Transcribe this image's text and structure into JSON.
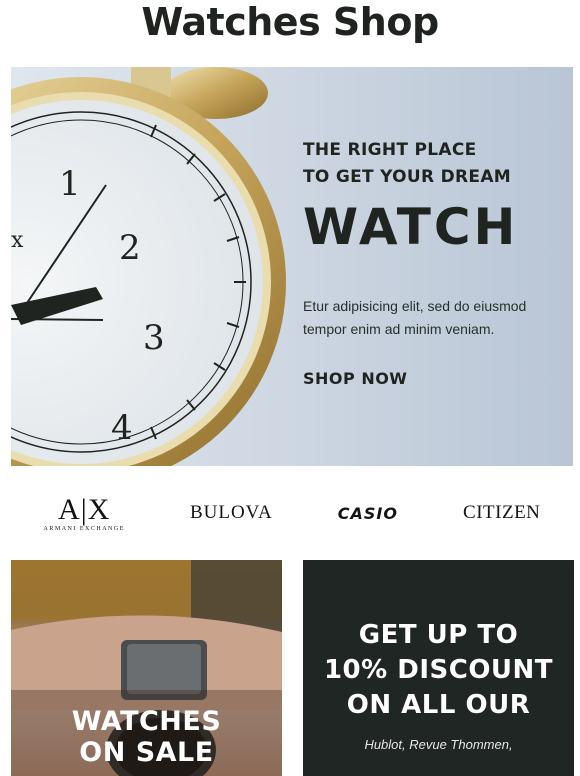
{
  "header": {
    "title": "Watches Shop"
  },
  "hero": {
    "kicker_line1": "THE RIGHT PLACE",
    "kicker_line2": "TO GET YOUR DREAM",
    "headline": "WATCH",
    "body": "Etur adipisicing elit, sed do eiusmod tempor enim ad minim veniam.",
    "cta": "SHOP NOW",
    "clock_numerals": [
      "1",
      "2",
      "3",
      "4",
      "x"
    ]
  },
  "brands": {
    "armani_mark": "A|X",
    "armani_sub": "ARMANI EXCHANGE",
    "bulova": "BULOVA",
    "casio": "CASIO",
    "citizen": "CITIZEN"
  },
  "promo_sale": {
    "title_line1": "WATCHES",
    "title_line2": "ON SALE"
  },
  "promo_discount": {
    "line1": "GET UP TO",
    "line2": "10% DISCOUNT",
    "line3": "ON ALL OUR",
    "subtitle": "Hublot, Revue Thommen,"
  },
  "colors": {
    "text_dark": "#1f2421",
    "discount_bg": "#202623",
    "hero_bg": "#cfd8e3"
  }
}
